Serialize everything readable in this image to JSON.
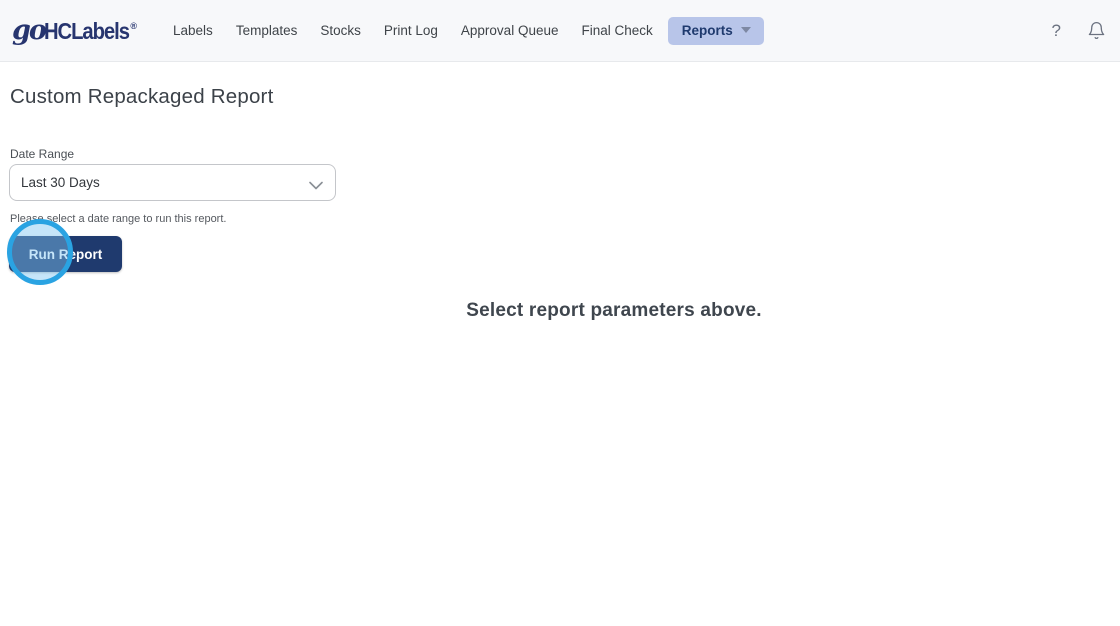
{
  "header": {
    "logo": {
      "script": "go",
      "text": "HCLabels",
      "registered": "®"
    },
    "nav": [
      {
        "label": "Labels"
      },
      {
        "label": "Templates"
      },
      {
        "label": "Stocks"
      },
      {
        "label": "Print Log"
      },
      {
        "label": "Approval Queue"
      },
      {
        "label": "Final Check"
      },
      {
        "label": "Reports"
      }
    ],
    "help_icon": "?",
    "bell_icon": "notification-bell"
  },
  "page": {
    "title": "Custom Repackaged Report"
  },
  "form": {
    "date_range_label": "Date Range",
    "date_range_value": "Last 30 Days",
    "helper_text": "Please select a date range to run this report.",
    "run_button_label": "Run Report"
  },
  "content": {
    "empty_state_message": "Select report parameters above."
  },
  "colors": {
    "brand_navy": "#27356f",
    "button_navy": "#1f3a6e",
    "active_nav_bg": "#b8c5e9",
    "header_bg": "#f7f8fa",
    "highlight_ring": "#2aa3e2",
    "highlight_fill": "rgba(126,198,241,0.45)"
  }
}
